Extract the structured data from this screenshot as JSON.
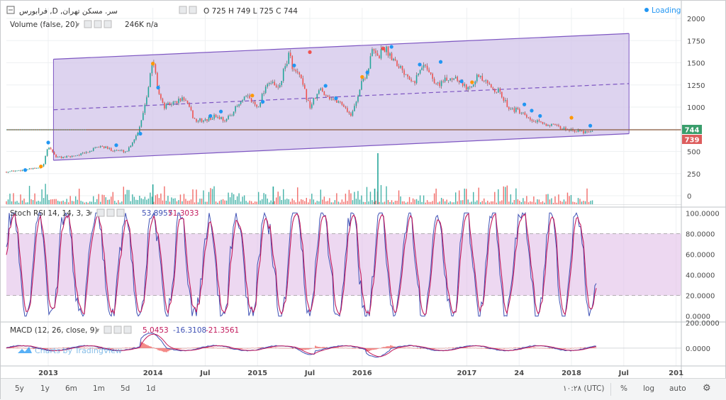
{
  "header": {
    "symbol": "فرابورس ,D ,سر. مسکن تهران",
    "ohlc": "O 725 H 749 L 725 C 744",
    "loading": "Loading"
  },
  "colors": {
    "up": "#26a69a",
    "down": "#ef5350",
    "price_line": "#8a5a3c",
    "channel": "#7e57c2",
    "channel_fill": "#d1c4e9",
    "stoch_k": "#3f51b5",
    "stoch_d": "#c2185b",
    "stoch_band": "#e1bee7",
    "macd": "#3f51b5",
    "signal": "#c2185b",
    "hist": "#ef5350",
    "badge_green": "#3a9e6c",
    "badge_red": "#dd5d5d",
    "marker_blue": "#2196f3",
    "marker_orange": "#ff9800"
  },
  "volume": {
    "label": "Volume (false, 20)",
    "value": "246K n/a"
  },
  "chart_data": [
    {
      "type": "line",
      "panel": "price",
      "ylim": [
        -120,
        2120
      ],
      "y_ticks": [
        0,
        250,
        500,
        750,
        1000,
        1250,
        1500,
        1750,
        2000
      ],
      "x_range": [
        2012.6,
        2019.05
      ],
      "x_ticks": [
        {
          "x": 2013.0,
          "label": "2013"
        },
        {
          "x": 2014.0,
          "label": "2014"
        },
        {
          "x": 2014.5,
          "label": "Jul"
        },
        {
          "x": 2015.0,
          "label": "2015"
        },
        {
          "x": 2015.5,
          "label": "Jul"
        },
        {
          "x": 2016.0,
          "label": "2016"
        },
        {
          "x": 2017.0,
          "label": "2017"
        },
        {
          "x": 2017.5,
          "label": "24"
        },
        {
          "x": 2018.0,
          "label": "2018"
        },
        {
          "x": 2018.5,
          "label": "Jul"
        },
        {
          "x": 2019.0,
          "label": "201"
        }
      ],
      "series": [
        {
          "x": [
            2012.6,
            2012.75,
            2012.9,
            2012.95,
            2013.0,
            2013.08,
            2013.2,
            2013.35,
            2013.5,
            2013.6,
            2013.75,
            2013.85,
            2013.9,
            2013.95,
            2014.0,
            2014.05,
            2014.1,
            2014.2,
            2014.3,
            2014.4,
            2014.5,
            2014.6,
            2014.7,
            2014.8,
            2014.9,
            2015.0,
            2015.1,
            2015.2,
            2015.3,
            2015.35,
            2015.4,
            2015.5,
            2015.6,
            2015.7,
            2015.8,
            2015.9,
            2016.0,
            2016.05,
            2016.1,
            2016.15,
            2016.2,
            2016.3,
            2016.4,
            2016.5,
            2016.6,
            2016.7,
            2016.8,
            2016.9,
            2017.0,
            2017.1,
            2017.2,
            2017.3,
            2017.4,
            2017.5,
            2017.6,
            2017.7,
            2017.8,
            2017.9,
            2018.0,
            2018.1,
            2018.2
          ],
          "close": [
            270,
            290,
            310,
            330,
            560,
            430,
            440,
            480,
            560,
            520,
            500,
            700,
            900,
            1200,
            1540,
            1200,
            1000,
            1050,
            1100,
            850,
            850,
            900,
            850,
            1000,
            1120,
            1000,
            1300,
            1200,
            1600,
            1400,
            1350,
            1000,
            1200,
            1100,
            1050,
            900,
            1300,
            1400,
            1650,
            1550,
            1680,
            1550,
            1400,
            1300,
            1500,
            1250,
            1300,
            1350,
            1200,
            1350,
            1250,
            1180,
            1000,
            950,
            850,
            820,
            800,
            760,
            750,
            720,
            744
          ]
        }
      ],
      "last_close": 744,
      "last_low_badge": 739,
      "horizontal_level": 744,
      "channel": {
        "upper": [
          [
            2013.05,
            1540
          ],
          [
            2018.55,
            1830
          ]
        ],
        "mid": [
          [
            2013.05,
            970
          ],
          [
            2018.55,
            1265
          ]
        ],
        "lower": [
          [
            2013.05,
            400
          ],
          [
            2018.55,
            700
          ]
        ]
      }
    },
    {
      "type": "line",
      "panel": "stoch_rsi",
      "label": "Stoch RSI 14, 14, 3, 3",
      "values_text": [
        "53.8957",
        "51.3033"
      ],
      "ylim": [
        -5,
        105
      ],
      "y_ticks": [
        "100.0000",
        "80.0000",
        "60.0000",
        "40.0000",
        "20.0000",
        "0.0000"
      ],
      "bands": [
        20,
        80
      ]
    },
    {
      "type": "line",
      "panel": "macd",
      "label": "MACD (12, 26, close, 9)",
      "values_text": [
        "5.0453",
        "-16.3108",
        "-21.3561"
      ],
      "ylim": [
        -140,
        200
      ],
      "y_ticks": [
        "200.0000",
        "0.0000"
      ]
    }
  ],
  "watermark": "Charts by TradingView",
  "bottom_bar": {
    "ranges": [
      "5y",
      "1y",
      "6m",
      "1m",
      "5d",
      "1d"
    ],
    "time": "۱۰:۲۸ (UTC)",
    "options": [
      "%",
      "log",
      "auto"
    ]
  }
}
